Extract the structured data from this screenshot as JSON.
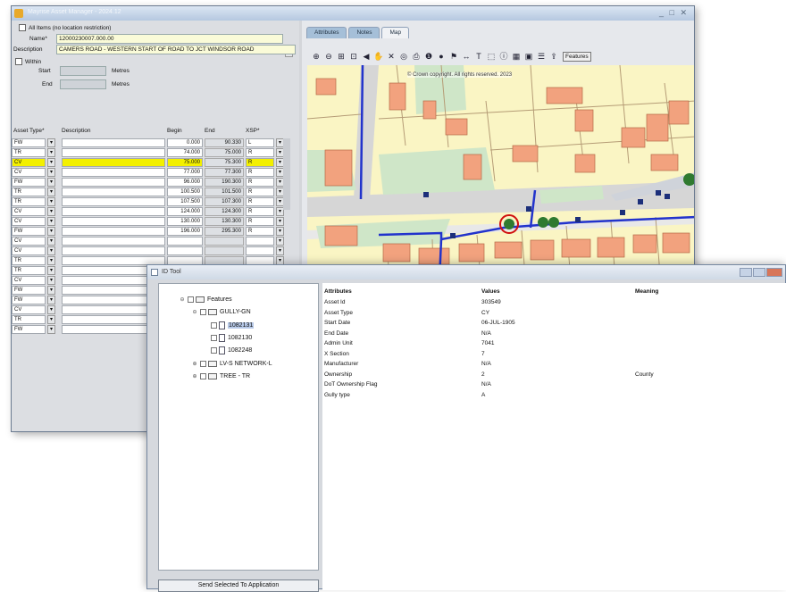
{
  "main_window": {
    "title": "Mayrise Asset Manager - 2024.12",
    "controls": "_ □ ✕",
    "all_items_label": "All Items (no location restriction)",
    "name_label": "Name*",
    "name_value": "12000230007.000.00",
    "description_label": "Description",
    "description_value": "CAMERS ROAD - WESTERN START OF ROAD TO JCT WINDSOR ROAD",
    "within_label": "Within",
    "start_label": "Start",
    "end_label": "End",
    "metres_label": "Metres",
    "grid": {
      "headers": [
        "Asset Type*",
        "Description",
        "Begin",
        "End",
        "XSP*"
      ],
      "rows": [
        {
          "type": "FW",
          "begin": "0.000",
          "end": "90.330",
          "xsp": "L"
        },
        {
          "type": "TR",
          "begin": "74.000",
          "end": "75.000",
          "xsp": "R"
        },
        {
          "type": "CV",
          "begin": "75.000",
          "end": "75.300",
          "xsp": "R"
        },
        {
          "type": "CV",
          "begin": "77.000",
          "end": "77.300",
          "xsp": "R"
        },
        {
          "type": "FW",
          "begin": "96.000",
          "end": "190.300",
          "xsp": "R"
        },
        {
          "type": "TR",
          "begin": "100.500",
          "end": "101.500",
          "xsp": "R"
        },
        {
          "type": "TR",
          "begin": "107.500",
          "end": "107.300",
          "xsp": "R"
        },
        {
          "type": "CV",
          "begin": "124.000",
          "end": "124.300",
          "xsp": "R"
        },
        {
          "type": "CV",
          "begin": "130.000",
          "end": "130.300",
          "xsp": "R"
        },
        {
          "type": "FW",
          "begin": "196.000",
          "end": "295.300",
          "xsp": "R"
        },
        {
          "type": "CV",
          "begin": "",
          "end": "",
          "xsp": ""
        },
        {
          "type": "CV",
          "begin": "",
          "end": "",
          "xsp": ""
        },
        {
          "type": "TR",
          "begin": "",
          "end": "",
          "xsp": ""
        },
        {
          "type": "TR",
          "begin": "",
          "end": "",
          "xsp": ""
        },
        {
          "type": "CV",
          "begin": "",
          "end": "",
          "xsp": ""
        },
        {
          "type": "FW",
          "begin": "",
          "end": "",
          "xsp": ""
        },
        {
          "type": "FW",
          "begin": "",
          "end": "",
          "xsp": ""
        },
        {
          "type": "CV",
          "begin": "",
          "end": "",
          "xsp": ""
        },
        {
          "type": "TR",
          "begin": "",
          "end": "",
          "xsp": ""
        },
        {
          "type": "FW",
          "begin": "",
          "end": "",
          "xsp": ""
        }
      ],
      "selected_row": 2
    },
    "tabs": [
      "Attributes",
      "Notes",
      "Map"
    ],
    "active_tab": 2,
    "toolbar_icons": [
      "zoom-in-icon",
      "zoom-out-icon",
      "zoom-box-icon",
      "zoom-extent-icon",
      "zoom-prev-icon",
      "pan-icon",
      "clear-icon",
      "locate-icon",
      "print-icon",
      "info-icon",
      "red-circle-icon",
      "flag-icon",
      "measure-icon",
      "text-icon",
      "select-icon",
      "id-tool-icon",
      "layers-icon",
      "photo-icon",
      "legend-icon",
      "export-icon"
    ],
    "toolbar_glyphs": [
      "⊕",
      "⊖",
      "⊞",
      "⊡",
      "◀",
      "✋",
      "✕",
      "◎",
      "⎙",
      "❶",
      "●",
      "⚑",
      "↔",
      "T",
      "⬚",
      "ⓘ",
      "▦",
      "▣",
      "☰",
      "⇪"
    ],
    "features_button": "Features",
    "map_copyright": "© Crown copyright. All rights reserved. 2023"
  },
  "id_tool": {
    "title": "ID Tool",
    "tree": {
      "root": "Features",
      "groups": [
        {
          "label": "GULLY-GN",
          "expanded": true,
          "children": [
            "1082131",
            "1082130",
            "1082248"
          ]
        },
        {
          "label": "LV-S NETWORK-L",
          "expanded": false,
          "children": []
        },
        {
          "label": "TREE - TR",
          "expanded": false,
          "children": []
        }
      ],
      "selected_child": "1082131"
    },
    "send_button": "Send Selected To Application",
    "columns": [
      "Attributes",
      "Values",
      "Meaning"
    ],
    "attributes": [
      {
        "name": "Asset Id",
        "value": "303549",
        "meaning": ""
      },
      {
        "name": "Asset Type",
        "value": "CY",
        "meaning": ""
      },
      {
        "name": "Start Date",
        "value": "06-JUL-1905",
        "meaning": ""
      },
      {
        "name": "End Date",
        "value": "N/A",
        "meaning": ""
      },
      {
        "name": "Admin Unit",
        "value": "7041",
        "meaning": ""
      },
      {
        "name": "X Section",
        "value": "7",
        "meaning": ""
      },
      {
        "name": "Manufacturer",
        "value": "N/A",
        "meaning": ""
      },
      {
        "name": "Ownership",
        "value": "2",
        "meaning": "County"
      },
      {
        "name": "DoT Ownership Flag",
        "value": "N/A",
        "meaning": ""
      },
      {
        "name": "Gully type",
        "value": "A",
        "meaning": ""
      }
    ]
  },
  "colors": {
    "selected_row": "#f3f000",
    "field_bg": "#fafbd8",
    "map_bg": "#faf5c4",
    "building": "#f2a27e",
    "road_line": "#2233cc",
    "grass": "#cfe6c8"
  }
}
